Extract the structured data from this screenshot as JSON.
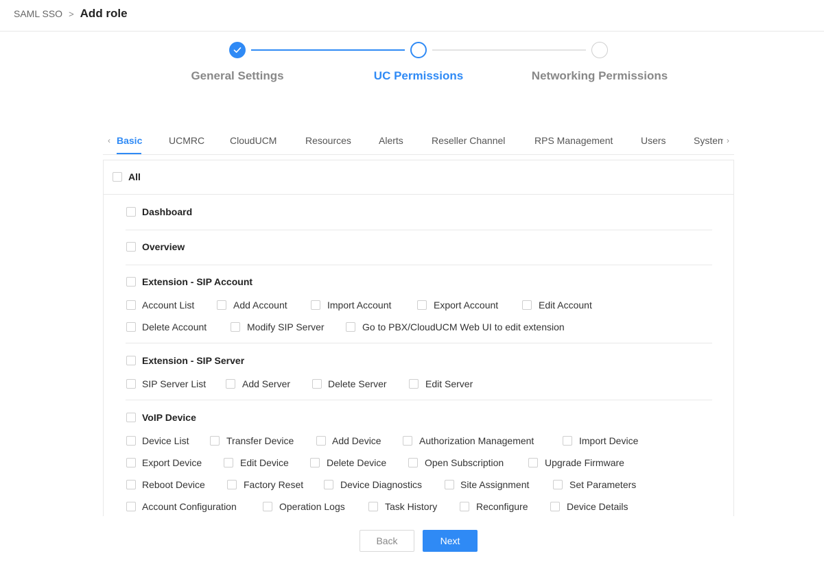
{
  "breadcrumb": {
    "parent": "SAML SSO",
    "separator": ">",
    "current": "Add role"
  },
  "colors": {
    "accent": "#2f8af5",
    "border": "#e8e8e8",
    "muted": "#888888"
  },
  "steps": [
    {
      "title": "General Settings",
      "state": "finished"
    },
    {
      "title": "UC Permissions",
      "state": "active"
    },
    {
      "title": "Networking Permissions",
      "state": "waiting"
    }
  ],
  "tabs": {
    "prev_icon": "chevron-left-icon",
    "next_icon": "chevron-right-icon",
    "items": [
      "Basic",
      "UCMRC",
      "CloudUCM",
      "Resources",
      "Alerts",
      "Reseller Channel",
      "RPS Management",
      "Users",
      "System"
    ],
    "active": "Basic"
  },
  "permissions": {
    "all_label": "All",
    "groups": [
      {
        "title": "Dashboard",
        "items": []
      },
      {
        "title": "Overview",
        "items": []
      },
      {
        "title": "Extension - SIP Account",
        "items": [
          "Account List",
          "Add Account",
          "Import Account",
          "Export Account",
          "Edit Account",
          "Delete Account",
          "Modify SIP Server",
          "Go to PBX/CloudUCM Web UI to edit extension"
        ]
      },
      {
        "title": "Extension - SIP Server",
        "items": [
          "SIP Server List",
          "Add Server",
          "Delete Server",
          "Edit Server"
        ]
      },
      {
        "title": "VoIP Device",
        "items": [
          "Device List",
          "Transfer Device",
          "Add Device",
          "Authorization Management",
          "Import Device",
          "Export Device",
          "Edit Device",
          "Delete Device",
          "Open Subscription",
          "Upgrade Firmware",
          "Reboot Device",
          "Factory Reset",
          "Device Diagnostics",
          "Site Assignment",
          "Set Parameters",
          "Account Configuration",
          "Operation Logs",
          "Task History",
          "Reconfigure",
          "Device Details"
        ]
      }
    ]
  },
  "footer": {
    "back_label": "Back",
    "next_label": "Next"
  }
}
